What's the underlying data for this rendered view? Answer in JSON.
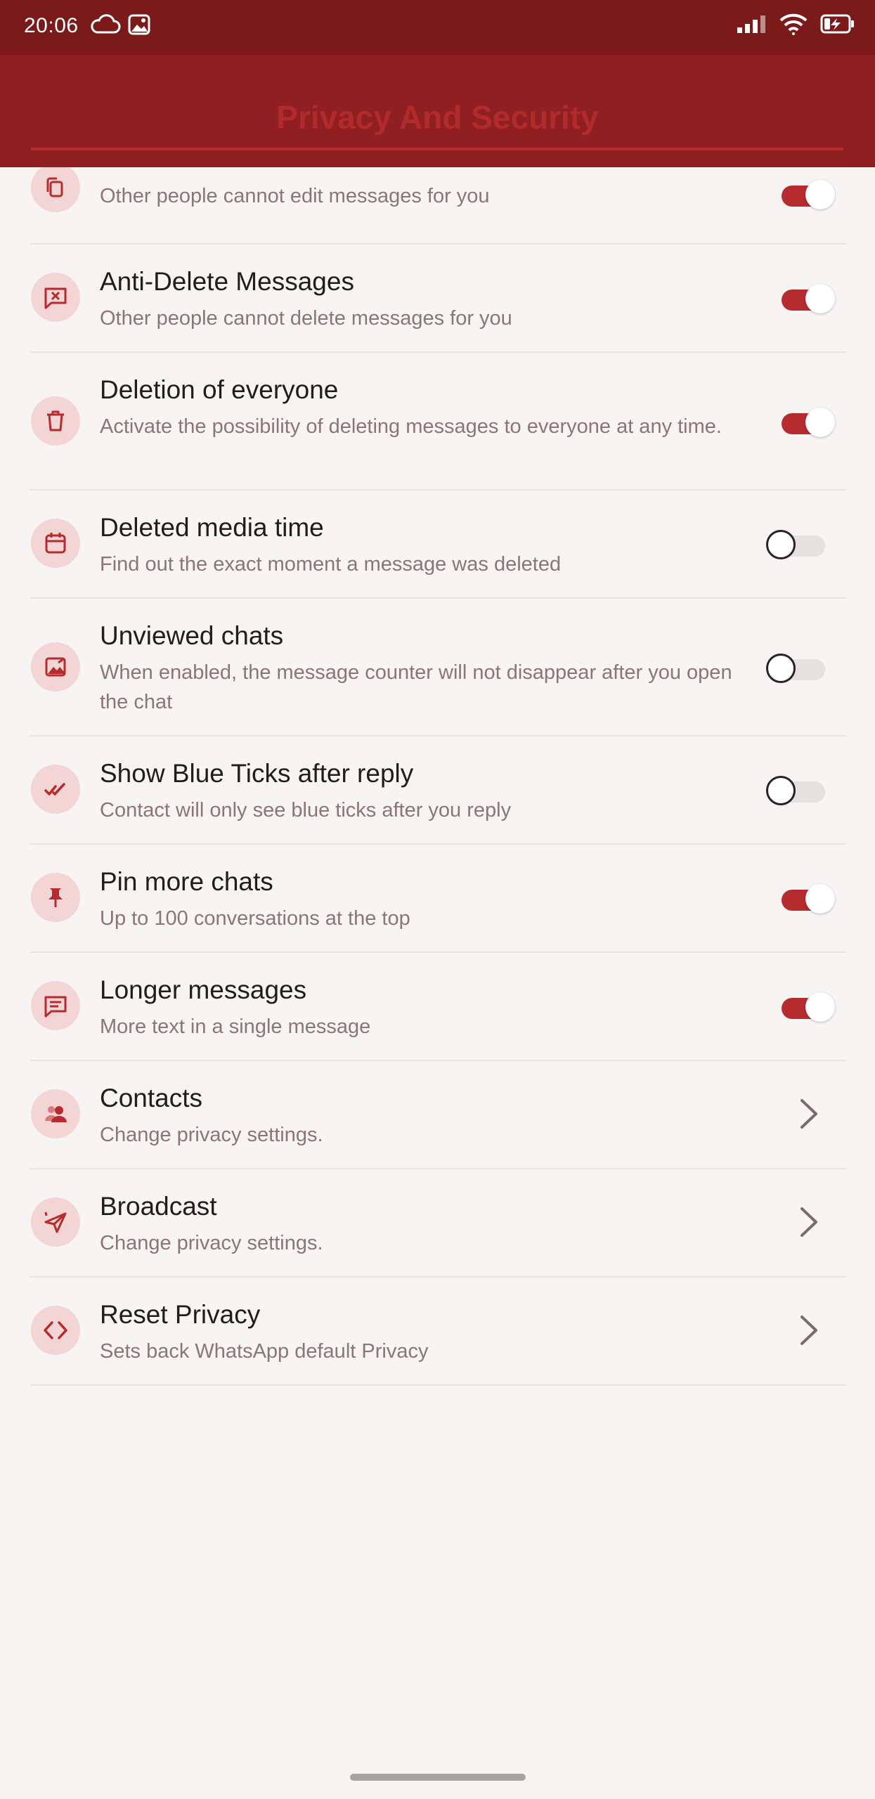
{
  "status_bar": {
    "time": "20:06"
  },
  "app_bar": {
    "title": "Privacy And Security"
  },
  "items": [
    {
      "title": "",
      "desc": "Other people cannot edit messages for you",
      "control": "on",
      "icon": "copy-icon"
    },
    {
      "title": "Anti-Delete Messages",
      "desc": "Other people cannot delete messages for you",
      "control": "on",
      "icon": "message-x-icon"
    },
    {
      "title": "Deletion of everyone",
      "desc": "Activate the possibility of deleting messages to everyone at any time.",
      "control": "on",
      "icon": "trash-icon"
    },
    {
      "title": "Deleted media time",
      "desc": "Find out the exact moment a message was deleted",
      "control": "off",
      "icon": "calendar-icon"
    },
    {
      "title": "Unviewed chats",
      "desc": "When enabled, the message counter will not disappear after you open the chat",
      "control": "off",
      "icon": "image-icon"
    },
    {
      "title": "Show Blue Ticks after reply",
      "desc": "Contact will only see blue ticks after you reply",
      "control": "off",
      "icon": "double-check-icon"
    },
    {
      "title": "Pin more chats",
      "desc": "Up to 100 conversations at the top",
      "control": "on",
      "icon": "pin-icon"
    },
    {
      "title": "Longer messages",
      "desc": "More text in a single message",
      "control": "on",
      "icon": "message-text-icon"
    },
    {
      "title": "Contacts",
      "desc": "Change privacy settings.",
      "control": "chevron",
      "icon": "people-icon"
    },
    {
      "title": "Broadcast",
      "desc": "Change privacy settings.",
      "control": "chevron",
      "icon": "send-icon"
    },
    {
      "title": "Reset Privacy",
      "desc": "Sets back WhatsApp default Privacy",
      "control": "chevron",
      "icon": "code-icon"
    }
  ],
  "colors": {
    "accent": "#b52b2e",
    "status_bar": "#7a1a1b",
    "app_bar": "#8f1f21",
    "background": "#f8f4f3",
    "icon_bg": "#f4d5d5"
  }
}
